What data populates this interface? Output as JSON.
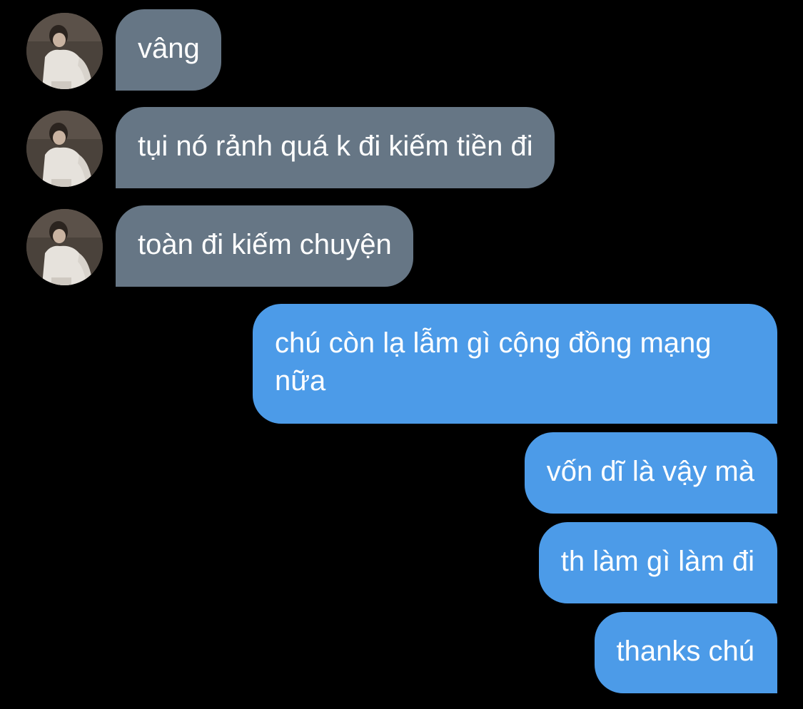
{
  "messages": [
    {
      "side": "incoming",
      "text": "vâng",
      "avatar": "contact-avatar"
    },
    {
      "side": "incoming",
      "text": "tụi nó rảnh quá k đi kiếm tiền đi",
      "avatar": "contact-avatar"
    },
    {
      "side": "incoming",
      "text": "toàn đi kiếm chuyện",
      "avatar": "contact-avatar"
    },
    {
      "side": "outgoing",
      "text": "chú còn lạ lẫm gì cộng đồng mạng nữa"
    },
    {
      "side": "outgoing",
      "text": "vốn dĩ là vậy mà"
    },
    {
      "side": "outgoing",
      "text": "th làm gì làm đi"
    },
    {
      "side": "outgoing",
      "text": "thanks chú"
    }
  ],
  "colors": {
    "background": "#000000",
    "incoming_bubble": "#667685",
    "outgoing_bubble": "#4c9be8",
    "text": "#ffffff"
  }
}
